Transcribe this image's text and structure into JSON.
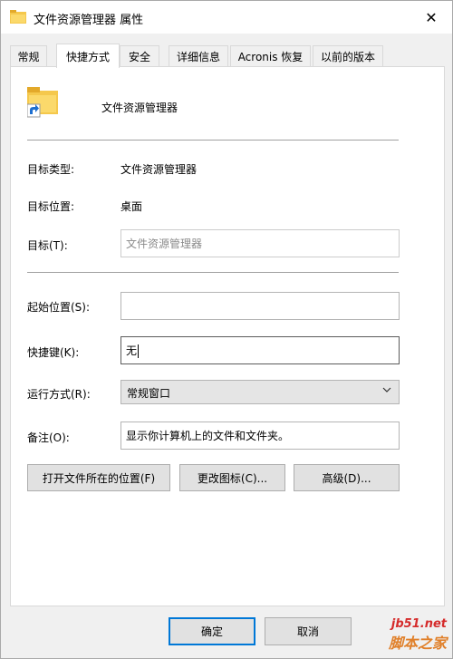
{
  "window": {
    "title": "文件资源管理器 属性",
    "close_glyph": "✕"
  },
  "tabs": [
    {
      "label": "常规"
    },
    {
      "label": "快捷方式"
    },
    {
      "label": "安全"
    },
    {
      "label": "详细信息"
    },
    {
      "label": "Acronis 恢复"
    },
    {
      "label": "以前的版本"
    }
  ],
  "active_tab": "快捷方式",
  "header": {
    "app_name": "文件资源管理器",
    "icon": "folder-shortcut-icon"
  },
  "props": {
    "target_type_label": "目标类型:",
    "target_type_value": "文件资源管理器",
    "target_location_label": "目标位置:",
    "target_location_value": "桌面",
    "target_label": "目标(T):",
    "target_value": "文件资源管理器",
    "start_in_label": "起始位置(S):",
    "start_in_value": "",
    "shortcut_key_label": "快捷键(K):",
    "shortcut_key_value": "无",
    "run_label": "运行方式(R):",
    "run_value": "常规窗口",
    "comment_label": "备注(O):",
    "comment_value": "显示你计算机上的文件和文件夹。"
  },
  "actions": {
    "open_location": "打开文件所在的位置(F)",
    "change_icon": "更改图标(C)...",
    "advanced": "高级(D)..."
  },
  "footer": {
    "ok": "确定",
    "cancel": "取消"
  },
  "watermark": {
    "line1": "jb51.net",
    "line2": "脚本之家"
  },
  "colors": {
    "accent": "#0078d7",
    "folder": "#f5c84c"
  }
}
